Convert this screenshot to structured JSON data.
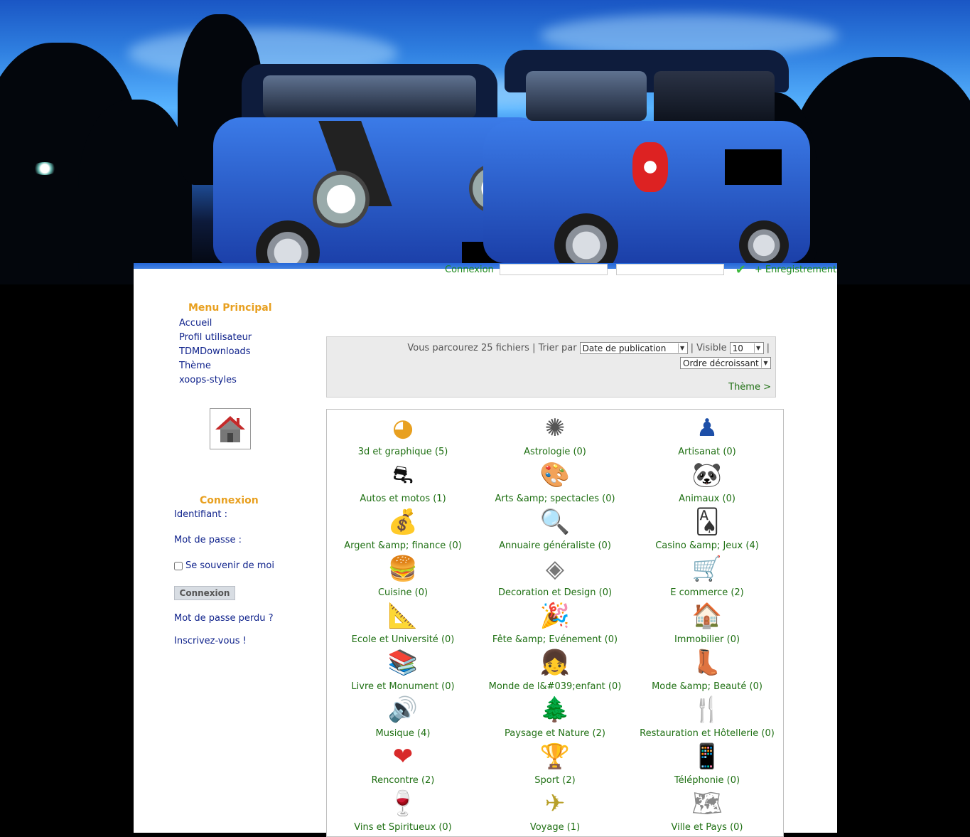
{
  "header": {
    "login_label": "Connexion",
    "register_link": "+ Enregistrement"
  },
  "main_menu": {
    "title": "Menu Principal",
    "items": [
      "Accueil",
      "Profil utilisateur",
      "TDMDownloads",
      "Thème",
      "xoops-styles"
    ]
  },
  "login": {
    "title": "Connexion",
    "username_label": "Identifiant :",
    "password_label": "Mot de passe :",
    "remember_label": "Se souvenir de moi",
    "submit_label": "Connexion",
    "lost_password": "Mot de passe perdu ?",
    "register": "Inscrivez-vous !"
  },
  "toolbar": {
    "browsing_text": "Vous parcourez 25 fichiers | Trier par",
    "sort_value": "Date de publication",
    "visible_text": "| Visible",
    "visible_value": "10",
    "trailing_sep": "|",
    "order_value": "Ordre décroissant",
    "theme_link": "Thème >"
  },
  "categories": [
    {
      "label": "3d et graphique (5)",
      "icon": "pie-chart-icon",
      "glyph": "◕"
    },
    {
      "label": "Astrologie (0)",
      "icon": "crab-icon",
      "glyph": "✺"
    },
    {
      "label": "Artisanat (0)",
      "icon": "artisan-icon",
      "glyph": "♟"
    },
    {
      "label": "Autos et motos (1)",
      "icon": "motorbike-icon",
      "glyph": "⛐"
    },
    {
      "label": "Arts &amp; spectacles (0)",
      "icon": "palette-icon",
      "glyph": "🎨"
    },
    {
      "label": "Animaux (0)",
      "icon": "panda-icon",
      "glyph": "🐼"
    },
    {
      "label": "Argent &amp; finance (0)",
      "icon": "money-icon",
      "glyph": "💰"
    },
    {
      "label": "Annuaire généraliste (0)",
      "icon": "magnifier-icon",
      "glyph": "🔍"
    },
    {
      "label": "Casino &amp; Jeux (4)",
      "icon": "cards-icon",
      "glyph": "🂡"
    },
    {
      "label": "Cuisine (0)",
      "icon": "burger-icon",
      "glyph": "🍔"
    },
    {
      "label": "Decoration et Design (0)",
      "icon": "design-icon",
      "glyph": "◈"
    },
    {
      "label": "E commerce (2)",
      "icon": "cart-icon",
      "glyph": "🛒"
    },
    {
      "label": "Ecole et Université (0)",
      "icon": "ruler-icon",
      "glyph": "📐"
    },
    {
      "label": "Fête &amp; Evénement (0)",
      "icon": "party-icon",
      "glyph": "🎉"
    },
    {
      "label": "Immobilier (0)",
      "icon": "house-icon",
      "glyph": "🏠"
    },
    {
      "label": "Livre et Monument (0)",
      "icon": "books-icon",
      "glyph": "📚"
    },
    {
      "label": "Monde de l&#039;enfant (0)",
      "icon": "child-icon",
      "glyph": "👧"
    },
    {
      "label": "Mode &amp; Beauté (0)",
      "icon": "boot-icon",
      "glyph": "👢"
    },
    {
      "label": "Musique (4)",
      "icon": "speaker-icon",
      "glyph": "🔊"
    },
    {
      "label": "Paysage et Nature (2)",
      "icon": "tree-icon",
      "glyph": "🌲"
    },
    {
      "label": "Restauration et Hôtellerie (0)",
      "icon": "restaurant-icon",
      "glyph": "🍴"
    },
    {
      "label": "Rencontre (2)",
      "icon": "heart-icon",
      "glyph": "❤"
    },
    {
      "label": "Sport (2)",
      "icon": "trophy-icon",
      "glyph": "🏆"
    },
    {
      "label": "Téléphonie (0)",
      "icon": "phone-icon",
      "glyph": "📱"
    },
    {
      "label": "Vins et Spiritueux (0)",
      "icon": "wine-icon",
      "glyph": "🍷"
    },
    {
      "label": "Voyage (1)",
      "icon": "plane-icon",
      "glyph": "✈"
    },
    {
      "label": "Ville et Pays (0)",
      "icon": "map-icon",
      "glyph": "🗺"
    }
  ],
  "colors": {
    "link": "#10238c",
    "category_text": "#1e6f12",
    "block_title": "#e8a020"
  }
}
